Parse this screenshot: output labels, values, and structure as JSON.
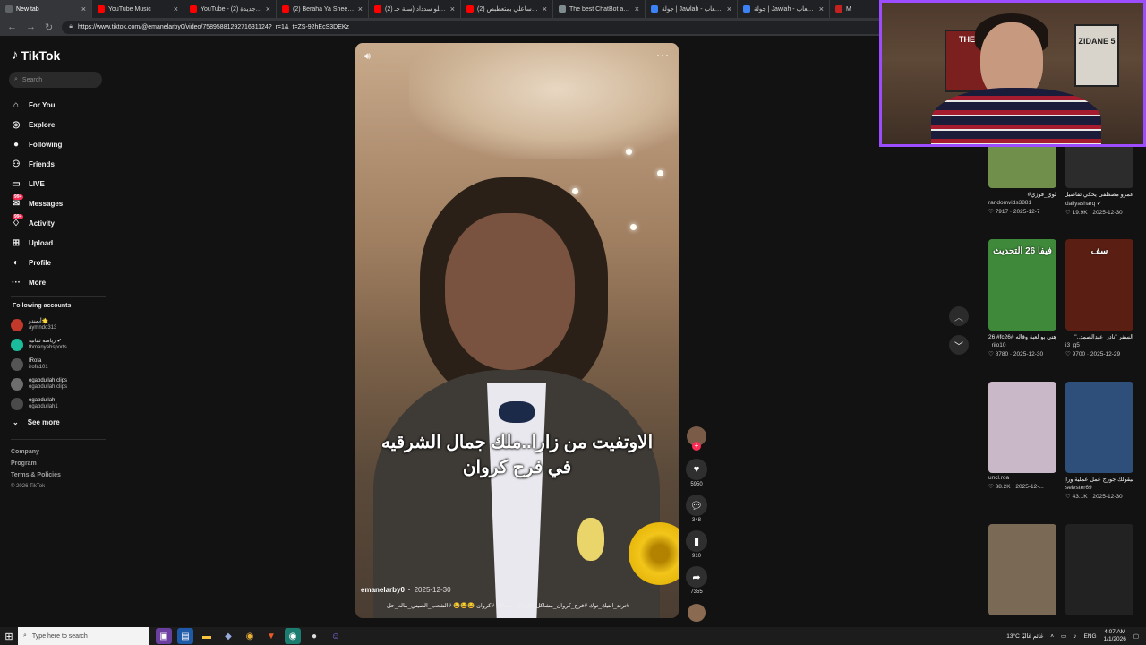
{
  "browser": {
    "tabs": [
      {
        "title": "New tab",
        "color": "#5f6368",
        "active": true
      },
      {
        "title": "YouTube Music",
        "color": "#ff0000"
      },
      {
        "title": "YouTube - (2) سنة جديدة",
        "color": "#ff0000"
      },
      {
        "title": "(2) Beraha Ya Sheekha - You",
        "color": "#ff0000"
      },
      {
        "title": "(2) ميوان بابلو سدداد (سنة جـ",
        "color": "#ff0000"
      },
      {
        "title": "(2) وكلات ساعلي بمتعطبص",
        "color": "#ff0000"
      },
      {
        "title": "The best ChatBot and Widg",
        "color": "#7f8c8d"
      },
      {
        "title": "جولة | Jawlah - منصة الألعاب",
        "color": "#3b82f6"
      },
      {
        "title": "جولة | Jawlah - منصة الألعاب",
        "color": "#3b82f6"
      },
      {
        "title": "M",
        "color": "#c5221f"
      }
    ],
    "url": "https://www.tiktok.com/@emanelarby0/video/7589588129271631124?_r=1&_t=ZS-92hEcS3DEKz"
  },
  "sidebar": {
    "logo": "TikTok",
    "search_placeholder": "Search",
    "nav": [
      {
        "label": "For You",
        "icon": "home-icon",
        "glyph": "⌂"
      },
      {
        "label": "Explore",
        "icon": "compass-icon",
        "glyph": "◎"
      },
      {
        "label": "Following",
        "icon": "following-icon",
        "glyph": "●"
      },
      {
        "label": "Friends",
        "icon": "friends-icon",
        "glyph": "⚇"
      },
      {
        "label": "LIVE",
        "icon": "live-icon",
        "glyph": "▭"
      },
      {
        "label": "Messages",
        "icon": "messages-icon",
        "glyph": "✉",
        "badge": "99+"
      },
      {
        "label": "Activity",
        "icon": "activity-icon",
        "glyph": "♢",
        "badge": "99+"
      },
      {
        "label": "Upload",
        "icon": "upload-icon",
        "glyph": "⊞"
      },
      {
        "label": "Profile",
        "icon": "profile-icon",
        "glyph": "◐"
      },
      {
        "label": "More",
        "icon": "more-icon",
        "glyph": "···"
      }
    ],
    "following_title": "Following accounts",
    "following": [
      {
        "name": "أيمندو🌟",
        "user": "aymndo313",
        "color": "#c0392b"
      },
      {
        "name": "رياضة ثمانية ✔",
        "user": "thmanyahsports",
        "color": "#1abc9c"
      },
      {
        "name": "IRofa",
        "user": "irofa101",
        "color": "#555"
      },
      {
        "name": "ogabdullah clips",
        "user": "ogabdullah.clips",
        "color": "#6d6d6d"
      },
      {
        "name": "ogabdullah",
        "user": "ogabdullah1",
        "color": "#4a4a4a"
      }
    ],
    "see_more": "See more",
    "footer": [
      "Company",
      "Program",
      "Terms & Policies"
    ],
    "copyright": "© 2026 TikTok"
  },
  "video": {
    "caption_line1": "الاوتفيت من زارا..ملك جمال الشرقيه",
    "caption_line2": "في فرح كروان",
    "author": "emanelarby0",
    "date": "2025-12-30",
    "hashtags": "#ترند_التيك_توك #فرح_كروان_مشاكل #كروان_مشاكل #كروان 😂😂😂 #الشعب_الصيني_ماله_حل",
    "likes": "5950",
    "comments": "348",
    "saves": "910",
    "shares": "7355"
  },
  "related": [
    {
      "title": "لوي_فوزي#",
      "user": "randomvids3881",
      "likes": "7917",
      "date": "2025-12-7",
      "bg": "#6f8f4a",
      "overlay": ""
    },
    {
      "title": "عمرو مصطفى يحكي تفاصيل أول مكالمة مع",
      "user": "dailyasharq ✔",
      "likes": "19.9K",
      "date": "2025-12-30",
      "bg": "#2c2c2c",
      "overlay": "أول مكالمة مع عمرو دياب"
    },
    {
      "title": "هتي بو لعبة وقاله #eafc26 #fc26...",
      "user": "_riio10",
      "likes": "8780",
      "date": "2025-12-30",
      "bg": "#3f8a3a",
      "overlay": "فيفا 26 التحديث"
    },
    {
      "title": "السفر \"نادر_عبدالصمد..\"",
      "user": "i3_g5",
      "likes": "9700",
      "date": "2025-12-29",
      "bg": "#5a1e12",
      "overlay": "سف"
    },
    {
      "title": "",
      "user": "uncl.roa",
      "likes": "38.2K",
      "date": "2025-12-...",
      "bg": "#c9b8c8",
      "overlay": ""
    },
    {
      "title": "بيقولك جورج عمل عملية وراح يتجوز",
      "user": "selvster69",
      "likes": "43.1K",
      "date": "2025-12-30",
      "bg": "#2d4f7a",
      "overlay": ""
    },
    {
      "title": "",
      "user": "",
      "likes": "",
      "date": "",
      "bg": "#7a6a55",
      "overlay": ""
    },
    {
      "title": "",
      "user": "",
      "likes": "",
      "date": "",
      "bg": "#222",
      "overlay": ""
    }
  ],
  "webcam": {
    "poster_text": "ZIDANE 5",
    "poster_text2": "THE"
  },
  "taskbar": {
    "search_placeholder": "Type here to search",
    "weather": "13°C غائم غالبًا",
    "lang": "ENG",
    "time": "4:07 AM",
    "date": "1/1/2026"
  }
}
